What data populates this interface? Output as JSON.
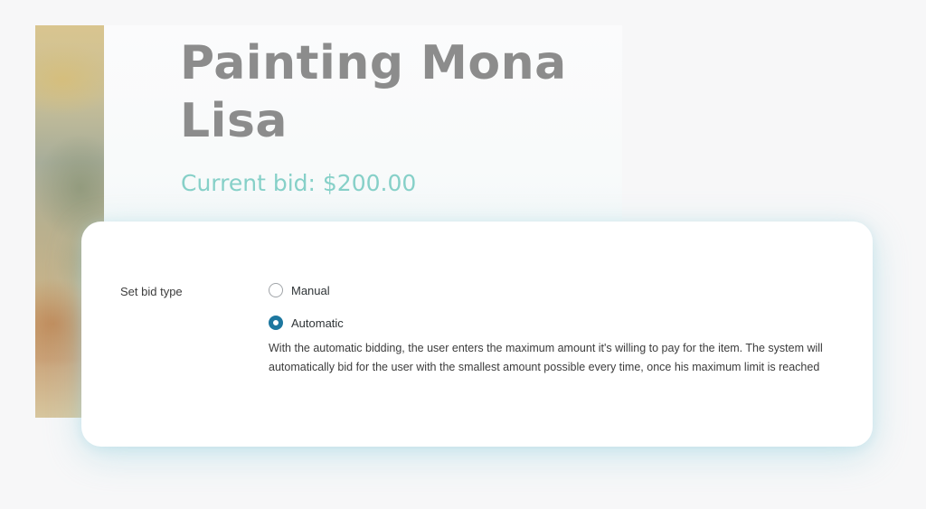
{
  "product": {
    "title": "Painting Mona Lisa",
    "current_bid": "Current bid: $200.00"
  },
  "bid_settings": {
    "label": "Set bid type",
    "options": [
      {
        "label": "Manual",
        "selected": false
      },
      {
        "label": "Automatic",
        "selected": true
      }
    ],
    "description": "With the automatic bidding, the user enters the maximum amount it's willing to pay for the item. The system will automatically bid for the user with the smallest amount possible every time, once his maximum limit is reached"
  },
  "colors": {
    "title": "#8c8c8c",
    "current_bid": "#86d0c8",
    "radio_selected": "#1d779f"
  }
}
